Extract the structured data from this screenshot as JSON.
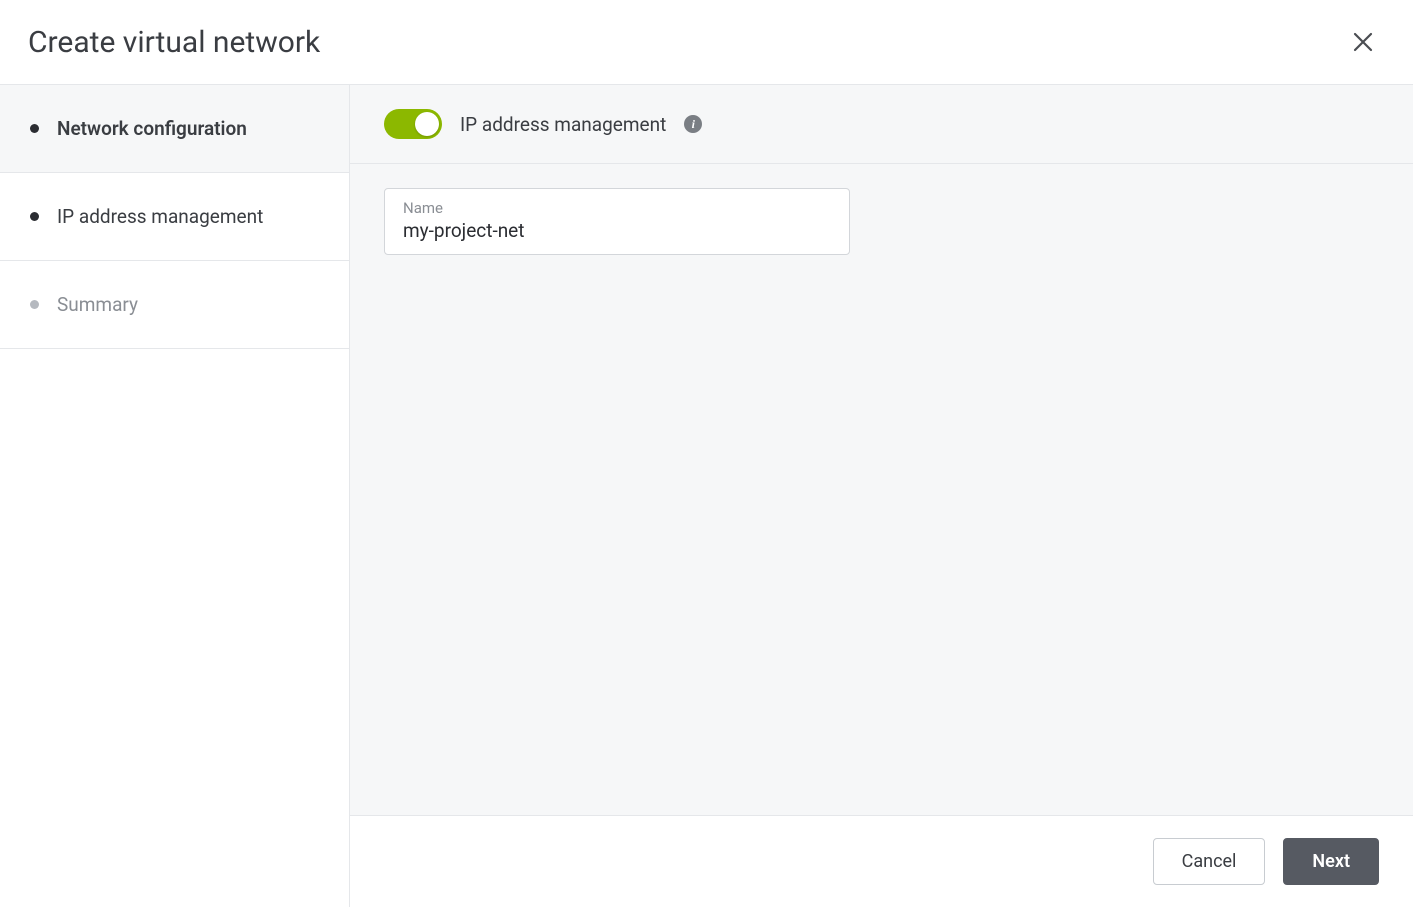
{
  "header": {
    "title": "Create virtual network"
  },
  "sidebar": {
    "items": [
      {
        "label": "Network configuration",
        "state": "active"
      },
      {
        "label": "IP address management",
        "state": "pending"
      },
      {
        "label": "Summary",
        "state": "disabled"
      }
    ]
  },
  "toggle": {
    "label": "IP address management",
    "on": true
  },
  "form": {
    "name_field": {
      "label": "Name",
      "value": "my-project-net"
    }
  },
  "footer": {
    "cancel": "Cancel",
    "next": "Next"
  },
  "colors": {
    "accent_green": "#8cb800",
    "button_primary": "#565a62"
  }
}
